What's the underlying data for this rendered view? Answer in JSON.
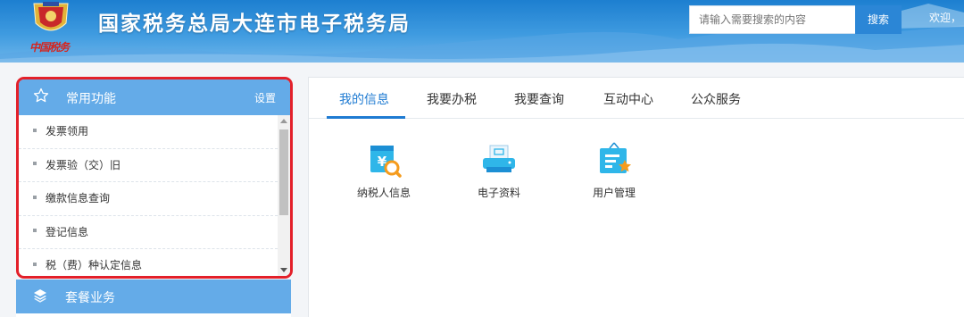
{
  "header": {
    "title": "国家税务总局大连市电子税务局",
    "brand_script": "中国税务",
    "search_placeholder": "请输入需要搜索的内容",
    "search_button": "搜索",
    "welcome": "欢迎，"
  },
  "sidebar": {
    "panel_title": "常用功能",
    "settings_label": "设置",
    "items": [
      {
        "label": "发票领用"
      },
      {
        "label": "发票验（交）旧"
      },
      {
        "label": "缴款信息查询"
      },
      {
        "label": "登记信息"
      },
      {
        "label": "税（费）种认定信息"
      }
    ],
    "package_title": "套餐业务"
  },
  "main": {
    "tabs": [
      {
        "label": "我的信息",
        "active": true
      },
      {
        "label": "我要办税"
      },
      {
        "label": "我要查询"
      },
      {
        "label": "互动中心"
      },
      {
        "label": "公众服务"
      }
    ],
    "tiles": [
      {
        "label": "纳税人信息",
        "icon": "taxpayer-info-icon"
      },
      {
        "label": "电子资料",
        "icon": "electronic-documents-icon"
      },
      {
        "label": "用户管理",
        "icon": "user-management-icon"
      }
    ]
  },
  "colors": {
    "header_blue": "#1d7fd0",
    "panel_head_blue": "#64abe8",
    "active_tab_blue": "#1f7bd2",
    "highlight_red": "#e3202a"
  }
}
